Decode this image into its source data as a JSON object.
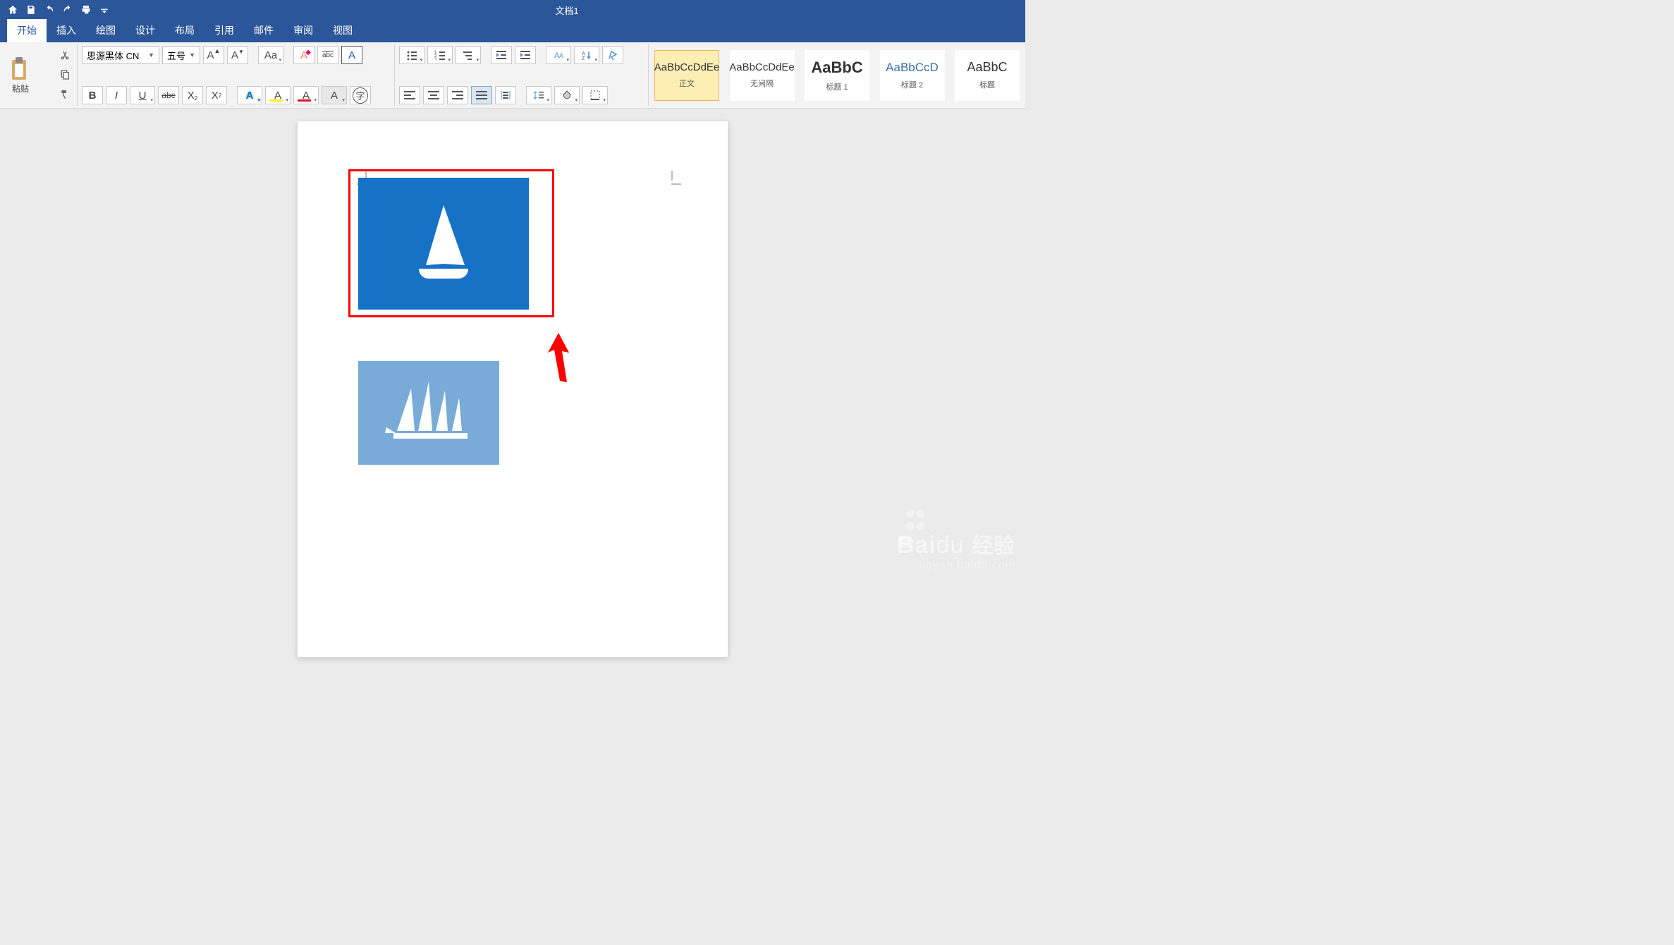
{
  "title": "文档1",
  "tabs": [
    "开始",
    "插入",
    "绘图",
    "设计",
    "布局",
    "引用",
    "邮件",
    "审阅",
    "视图"
  ],
  "active_tab": 0,
  "clipboard": {
    "paste": "粘贴"
  },
  "font": {
    "family": "思源黑体 CN",
    "size": "五号",
    "grow": "A",
    "shrink": "A",
    "changecase": "Aa",
    "clearfmt": "A",
    "phonetic": "abc",
    "charborder": "A",
    "bold": "B",
    "italic": "I",
    "underline": "U",
    "strike": "abc",
    "subscript_x": "X",
    "subscript_2": "2",
    "superscript_x": "X",
    "superscript_2": "2",
    "texteffect": "A",
    "highlight": "A",
    "fontcolor": "A",
    "shading": "A",
    "enclose": "字"
  },
  "styles": [
    {
      "preview": "AaBbCcDdEe",
      "name": "正文",
      "cls": ""
    },
    {
      "preview": "AaBbCcDdEe",
      "name": "无间隔",
      "cls": ""
    },
    {
      "preview": "AaBbC",
      "name": "标题 1",
      "cls": "big"
    },
    {
      "preview": "AaBbCcD",
      "name": "标题 2",
      "cls": "med"
    },
    {
      "preview": "AaBbC",
      "name": "标题",
      "cls": ""
    }
  ],
  "watermark": {
    "brand": "Baidu",
    "cn": "经验",
    "url": "jingyan.baidu.com"
  }
}
